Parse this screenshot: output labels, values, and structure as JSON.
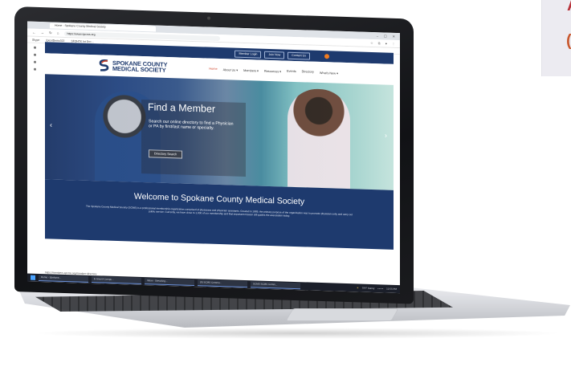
{
  "browser": {
    "tab_title": "Home - Spokane County Medical Society",
    "url": "https://www.spcms.org",
    "bookmarks": [
      "Skype",
      "ExcelDemo322",
      "SFOHTK Int Doc..."
    ],
    "window_controls": [
      "–",
      "☐",
      "✕"
    ]
  },
  "site": {
    "logo_line1": "SPOKANE COUNTY",
    "logo_line2": "MEDICAL SOCIETY",
    "top_buttons": [
      "Member Login",
      "Join Now",
      "Contact Us"
    ],
    "menu": [
      "Home",
      "About Us ▾",
      "Members ▾",
      "Resources ▾",
      "Events",
      "Directory",
      "What's New ▾"
    ],
    "hero": {
      "title": "Find a Member",
      "text": "Search our online directory to find a Physician or PA by first/last name or specialty.",
      "button": "Directory Search",
      "prev": "‹",
      "next": "›"
    },
    "welcome": {
      "title": "Welcome to Spokane County Medical Society",
      "text": "The Spokane County Medical Society (SCMS) is a professional membership organization comprised of physicians and physician assistants. Created in 1889, the primary purpose of the organization was to promote physician unity and carry out public service. Currently, we have close to 1,000 of our membership and that important mission still guides the association today."
    },
    "status_url": "https://members.spcms.org/member-directory"
  },
  "taskbar": {
    "items": [
      "Home - Spokane...",
      "E-Sound Compu...",
      "Inbox - SteveAng...",
      "(8) SCMS Commu...",
      "SCMS SCMS Comm..."
    ],
    "tray_weather": "79°F Sunny",
    "tray_time": "12:55 PM"
  },
  "colors": {
    "navy": "#1e3a6e",
    "accent_red": "#d0452b",
    "accent_orange": "#f07b20"
  }
}
